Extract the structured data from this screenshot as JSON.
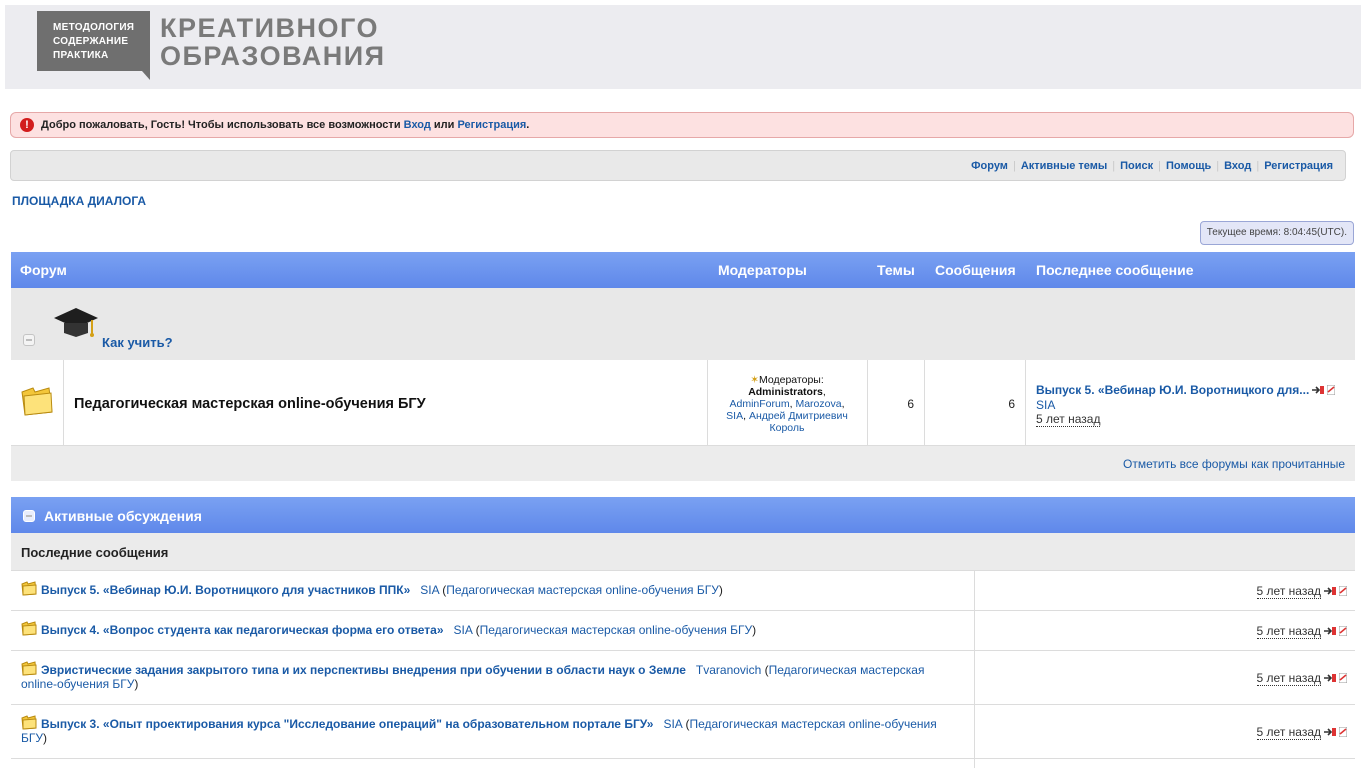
{
  "header": {
    "logo_small_lines": [
      "МЕТОДОЛОГИЯ",
      "СОДЕРЖАНИЕ",
      "ПРАКТИКА"
    ],
    "logo_big_lines": [
      "КРЕАТИВНОГО",
      "ОБРАЗОВАНИЯ"
    ]
  },
  "welcome": {
    "text": "Добро пожаловать, Гость! Чтобы использовать все возможности ",
    "login": "Вход",
    "or": " или ",
    "register": "Регистрация",
    "end": "."
  },
  "topnav": [
    "Форум",
    "Активные темы",
    "Поиск",
    "Помощь",
    "Вход",
    "Регистрация"
  ],
  "breadcrumb": "ПЛОЩАДКА ДИАЛОГА",
  "current_time": "Текущее время: 8:04:45(UTC).",
  "forum_table": {
    "headers": {
      "forum": "Форум",
      "moderators": "Модераторы",
      "topics": "Темы",
      "posts": "Сообщения",
      "last": "Последнее сообщение"
    },
    "category": "Как учить?",
    "forum": {
      "title": "Педагогическая мастерская online-обучения БГУ",
      "moderators_label": "Модераторы:",
      "mod_admins": "Administrators",
      "mods": [
        "AdminForum",
        "Marozova",
        "SIA",
        "Андрей Дмитриевич Король"
      ],
      "topics": "6",
      "posts": "6",
      "last_title": "Выпуск 5. «Вебинар Ю.И. Воротницкого для...",
      "last_author": "SIA",
      "last_time": "5 лет назад"
    },
    "mark_all": "Отметить все форумы как прочитанные"
  },
  "active": {
    "title": "Активные обсуждения",
    "subtitle": "Последние сообщения",
    "topics": [
      {
        "title": "Выпуск 5. «Вебинар Ю.И. Воротницкого для участников ППК»",
        "author": "SIA",
        "forum": "Педагогическая мастерская online-обучения БГУ",
        "time": "5 лет назад"
      },
      {
        "title": "Выпуск 4. «Вопрос студента как педагогическая форма его ответа»",
        "author": "SIA",
        "forum": "Педагогическая мастерская online-обучения БГУ",
        "time": "5 лет назад"
      },
      {
        "title": "Эвристические задания закрытого типа и их перспективы внедрения при обучении в области наук о Земле",
        "author": "Tvaranovich",
        "forum": "Педагогическая мастерская online-обучения БГУ",
        "time": "5 лет назад"
      },
      {
        "title": "Выпуск 3. «Опыт проектирования курса \"Исследование операций\" на образовательном портале БГУ»",
        "author": "SIA",
        "forum": "Педагогическая мастерская online-обучения БГУ",
        "time": "5 лет назад"
      }
    ]
  }
}
